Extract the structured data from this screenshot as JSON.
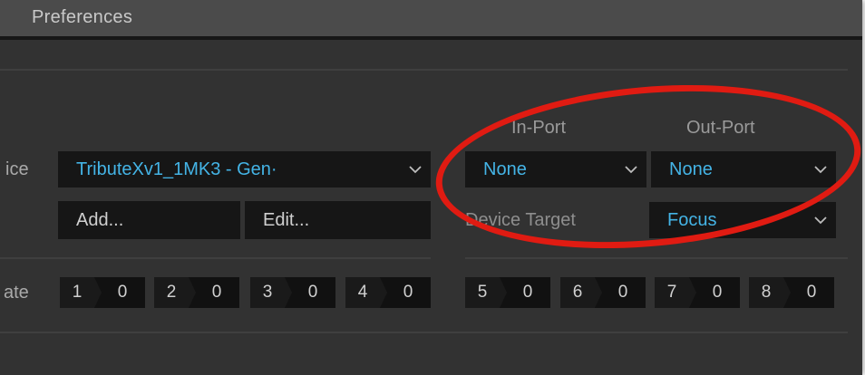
{
  "window": {
    "title": "Preferences"
  },
  "device": {
    "label": "ice",
    "selected": "TributeXv1_1MK3 - Gen·",
    "chevron_icon": "chevron-down-icon",
    "add_label": "Add...",
    "edit_label": "Edit..."
  },
  "ports": {
    "in_label": "In-Port",
    "out_label": "Out-Port",
    "in_value": "None",
    "out_value": "None"
  },
  "target": {
    "label": "Device Target",
    "value": "Focus"
  },
  "cc_row": {
    "label": "ate",
    "items": [
      {
        "num": "1",
        "val": "0"
      },
      {
        "num": "2",
        "val": "0"
      },
      {
        "num": "3",
        "val": "0"
      },
      {
        "num": "4",
        "val": "0"
      },
      {
        "num": "5",
        "val": "0"
      },
      {
        "num": "6",
        "val": "0"
      },
      {
        "num": "7",
        "val": "0"
      },
      {
        "num": "8",
        "val": "0"
      }
    ]
  },
  "colors": {
    "accent": "#44b4e6",
    "highlight": "#e01b12",
    "panel": "#161616",
    "background": "#323232"
  }
}
